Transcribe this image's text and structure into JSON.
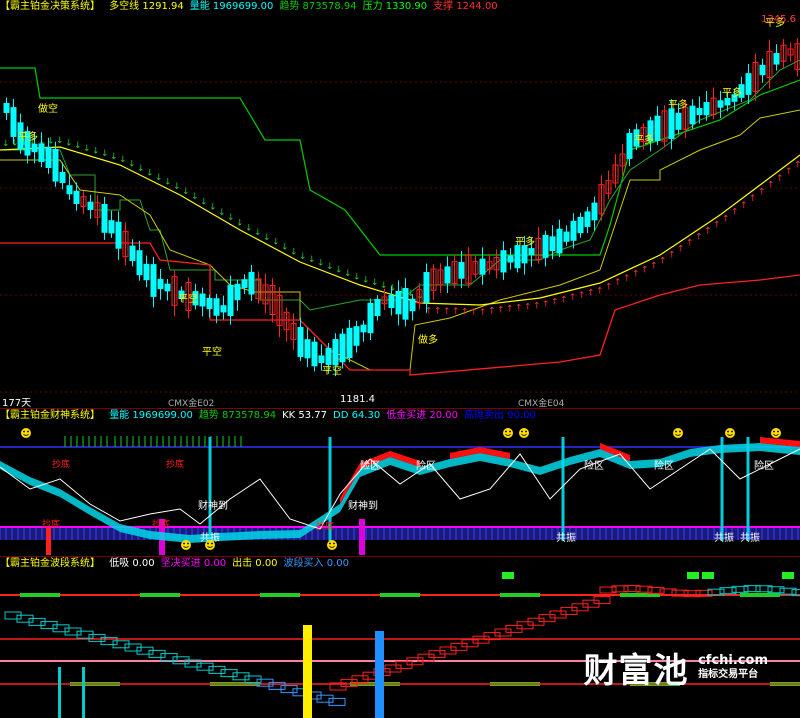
{
  "panel1": {
    "name": "【霸主铂金决策系统】",
    "items": [
      {
        "label": "多空线",
        "value": "1291.94",
        "color": "#ffff00"
      },
      {
        "label": "量能",
        "value": "1969699.00",
        "color": "#00ffff"
      },
      {
        "label": "趋势",
        "value": "873578.94",
        "color": "#00cc00"
      },
      {
        "label": "压力",
        "value": "1330.90",
        "color": "#00ff00"
      },
      {
        "label": "支撑",
        "value": "1244.00",
        "color": "#ff3030"
      }
    ],
    "price_high": "1345.6",
    "price_low": "1181.4",
    "period_label": "177天",
    "contract_labels": [
      "CMX金E02",
      "CMX金E04"
    ],
    "annotations": {
      "flat_long": "平多",
      "flat_short": "平空",
      "go_short": "做空",
      "go_long": "做多"
    }
  },
  "panel2": {
    "name": "【霸主铂金财神系统】",
    "items": [
      {
        "label": "量能",
        "value": "1969699.00",
        "color": "#00ffff"
      },
      {
        "label": "趋势",
        "value": "873578.94",
        "color": "#00cc00"
      },
      {
        "label": "KK",
        "value": "53.77",
        "color": "#ffffff"
      },
      {
        "label": "DD",
        "value": "64.30",
        "color": "#00ffff"
      },
      {
        "label": "低金买进",
        "value": "20.00",
        "color": "#ff00ff"
      },
      {
        "label": "高抛卖出",
        "value": "90.00",
        "color": "#0000ff"
      }
    ],
    "annotations": {
      "risk_zone": "险区",
      "resonance": "共振",
      "wealth_arrives": "财神到",
      "buy": "抄底"
    }
  },
  "panel3": {
    "name": "【霸主铂金波段系统】",
    "items": [
      {
        "label": "低吸",
        "value": "0.00",
        "color": "#ffffff"
      },
      {
        "label": "坚决买进",
        "value": "0.00",
        "color": "#ff00ff"
      },
      {
        "label": "出击",
        "value": "0.00",
        "color": "#ffff00"
      },
      {
        "label": "波段买入",
        "value": "0.00",
        "color": "#3399ff"
      }
    ]
  },
  "watermark": {
    "brand": "财富池",
    "domain": "cfchi.com",
    "tagline": "指标交易平台"
  },
  "colors": {
    "up": "#ff2020",
    "down": "#00ffff",
    "resistance": "#00cc00",
    "support": "#ff2020",
    "midline": "#ffff00"
  }
}
